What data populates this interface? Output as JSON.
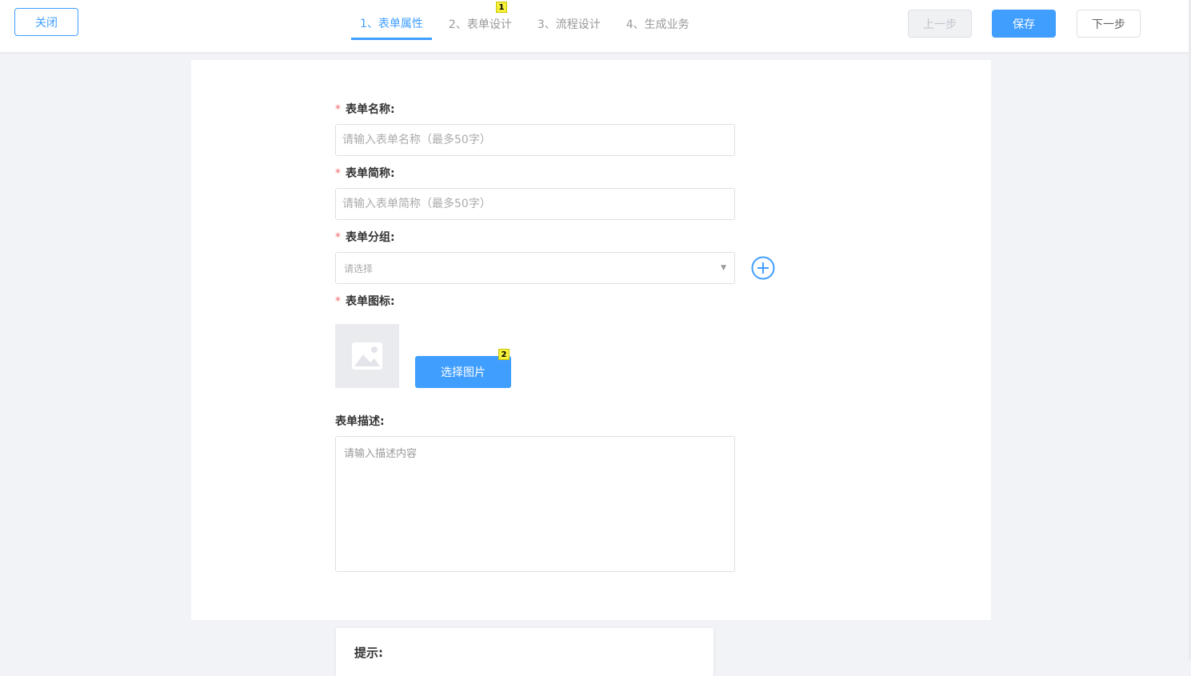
{
  "header": {
    "close_label": "关闭",
    "prev_label": "上一步",
    "save_label": "保存",
    "next_label": "下一步",
    "steps": [
      {
        "label": "1、表单属性"
      },
      {
        "label": "2、表单设计"
      },
      {
        "label": "3、流程设计"
      },
      {
        "label": "4、生成业务"
      }
    ],
    "active_step": 1
  },
  "badges": {
    "b1": "1",
    "b2": "2"
  },
  "form": {
    "name": {
      "label": "表单名称:",
      "required_mark": "*",
      "placeholder": "请输入表单名称（最多50字）"
    },
    "short_name": {
      "label": "表单简称:",
      "required_mark": "*",
      "placeholder": "请输入表单简称（最多50字）"
    },
    "group": {
      "label": "表单分组:",
      "required_mark": "*",
      "placeholder": "请选择"
    },
    "icon": {
      "label": "表单图标:",
      "required_mark": "*",
      "choose_label": "选择图片"
    },
    "description": {
      "label": "表单描述:",
      "placeholder": "请输入描述内容"
    }
  },
  "tip": {
    "title": "提示:"
  },
  "colors": {
    "primary": "#409eff",
    "required": "#f56c6c",
    "background": "#f2f3f6"
  }
}
